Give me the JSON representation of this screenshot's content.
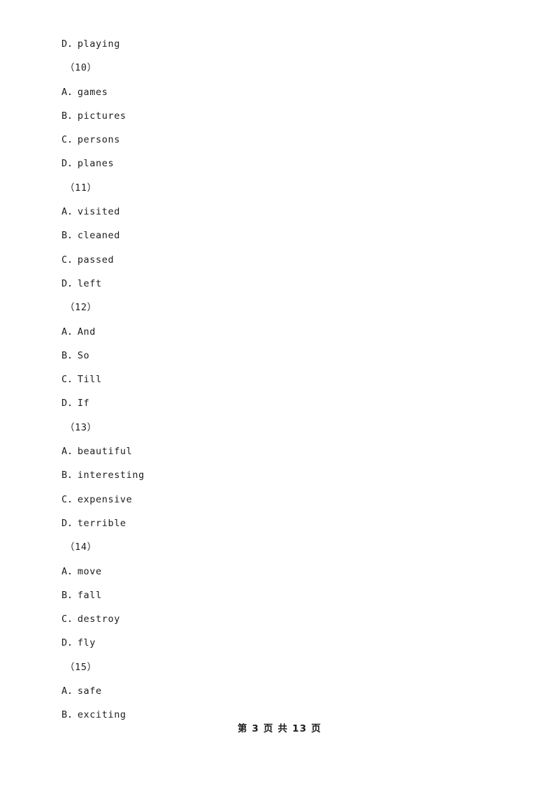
{
  "document": {
    "type": "exam-worksheet",
    "background_color": "#ffffff",
    "text_color": "#1d1d1d"
  },
  "body_lines": [
    {
      "kind": "option",
      "text": "D．playing"
    },
    {
      "kind": "qnum",
      "text": "（10）"
    },
    {
      "kind": "option",
      "text": "A．games"
    },
    {
      "kind": "option",
      "text": "B．pictures"
    },
    {
      "kind": "option",
      "text": "C．persons"
    },
    {
      "kind": "option",
      "text": "D．planes"
    },
    {
      "kind": "qnum",
      "text": "（11）"
    },
    {
      "kind": "option",
      "text": "A．visited"
    },
    {
      "kind": "option",
      "text": "B．cleaned"
    },
    {
      "kind": "option",
      "text": "C．passed"
    },
    {
      "kind": "option",
      "text": "D．left"
    },
    {
      "kind": "qnum",
      "text": "（12）"
    },
    {
      "kind": "option",
      "text": "A．And"
    },
    {
      "kind": "option",
      "text": "B．So"
    },
    {
      "kind": "option",
      "text": "C．Till"
    },
    {
      "kind": "option",
      "text": "D．If"
    },
    {
      "kind": "qnum",
      "text": "（13）"
    },
    {
      "kind": "option",
      "text": "A．beautiful"
    },
    {
      "kind": "option",
      "text": "B．interesting"
    },
    {
      "kind": "option",
      "text": "C．expensive"
    },
    {
      "kind": "option",
      "text": "D．terrible"
    },
    {
      "kind": "qnum",
      "text": "（14）"
    },
    {
      "kind": "option",
      "text": "A．move"
    },
    {
      "kind": "option",
      "text": "B．fall"
    },
    {
      "kind": "option",
      "text": "C．destroy"
    },
    {
      "kind": "option",
      "text": "D．fly"
    },
    {
      "kind": "qnum",
      "text": "（15）"
    },
    {
      "kind": "option",
      "text": "A．safe"
    },
    {
      "kind": "option",
      "text": "B．exciting"
    }
  ],
  "footer": {
    "text": "第 3 页 共 13 页",
    "current_page": "3",
    "total_pages": "13"
  }
}
